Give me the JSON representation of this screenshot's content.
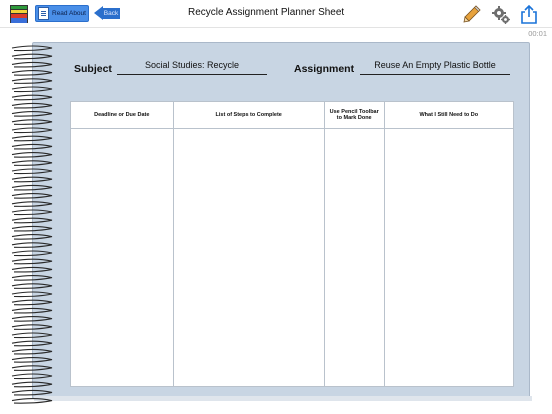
{
  "toolbar": {
    "read_about_label": "Read About",
    "back_label": "Back",
    "title": "Recycle Assignment Planner Sheet"
  },
  "timer": "00:01",
  "sheet": {
    "subject_label": "Subject",
    "subject_value": "Social Studies: Recycle",
    "assignment_label": "Assignment",
    "assignment_value": "Reuse An Empty Plastic Bottle",
    "columns": [
      "Deadline or Due Date",
      "List of Steps to Complete",
      "Use Pencil Toolbar to Mark Done",
      "What I Still Need to Do"
    ]
  },
  "colors": {
    "accent": "#2b6fcc",
    "page": "#c8d5e3",
    "share": "#1a73d9"
  },
  "icons": [
    "menu-icon",
    "document-icon",
    "back-arrow-icon",
    "pencil-icon",
    "gear-icon",
    "share-icon",
    "spiral-binding"
  ]
}
